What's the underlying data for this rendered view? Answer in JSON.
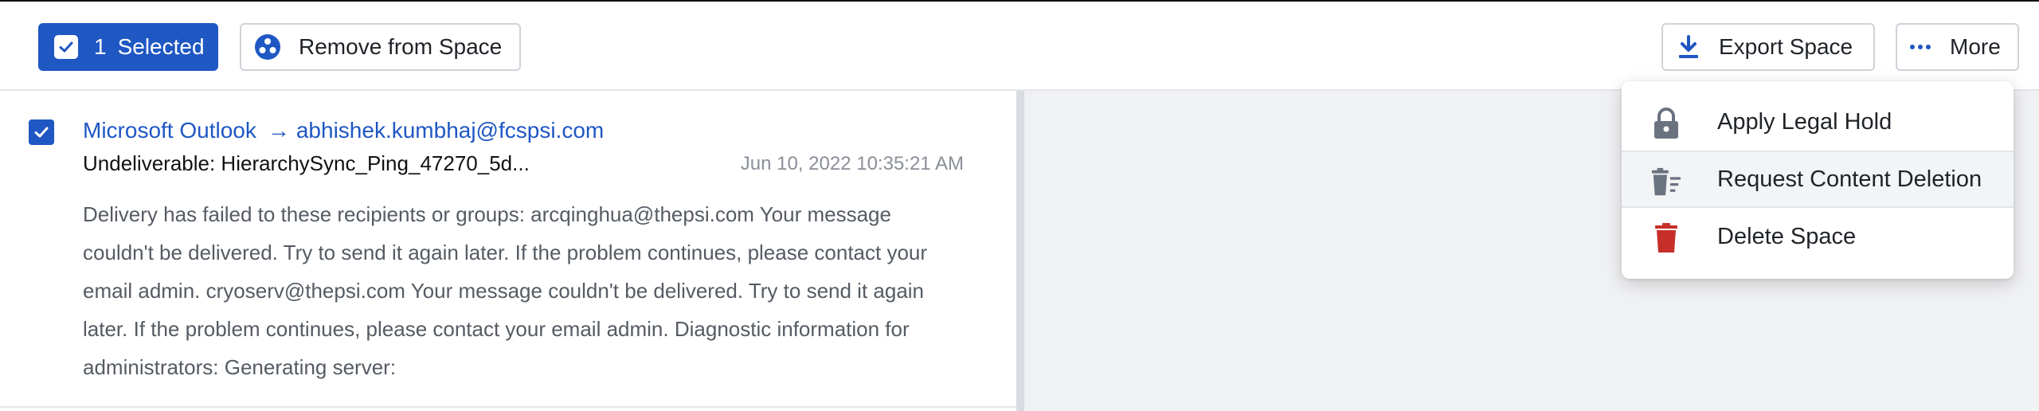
{
  "toolbar": {
    "selected_count": "1",
    "selected_label": "Selected",
    "remove_label": "Remove from Space",
    "export_label": "Export Space",
    "more_label": "More"
  },
  "message": {
    "source": "Microsoft Outlook",
    "arrow": "→",
    "recipient": "abhishek.kumbhaj@fcspsi.com",
    "subject": "Undeliverable: HierarchySync_Ping_47270_5d...",
    "timestamp": "Jun 10, 2022 10:35:21 AM",
    "preview": "Delivery has failed to these recipients or groups: arcqinghua@thepsi.com Your message couldn't be delivered. Try to send it again later. If the problem continues, please contact your email admin. cryoserv@thepsi.com Your message couldn't be delivered. Try to send it again later. If the problem continues, please contact your email admin. Diagnostic information for administrators: Generating server:",
    "checked": true
  },
  "more_menu": {
    "items": [
      {
        "label": "Apply Legal Hold",
        "icon": "lock-icon"
      },
      {
        "label": "Request Content Deletion",
        "icon": "trash-list-icon"
      },
      {
        "label": "Delete Space",
        "icon": "trash-icon"
      }
    ]
  },
  "colors": {
    "accent": "#1f57c3",
    "danger": "#c62f2a",
    "icon_gray": "#6b7280"
  }
}
